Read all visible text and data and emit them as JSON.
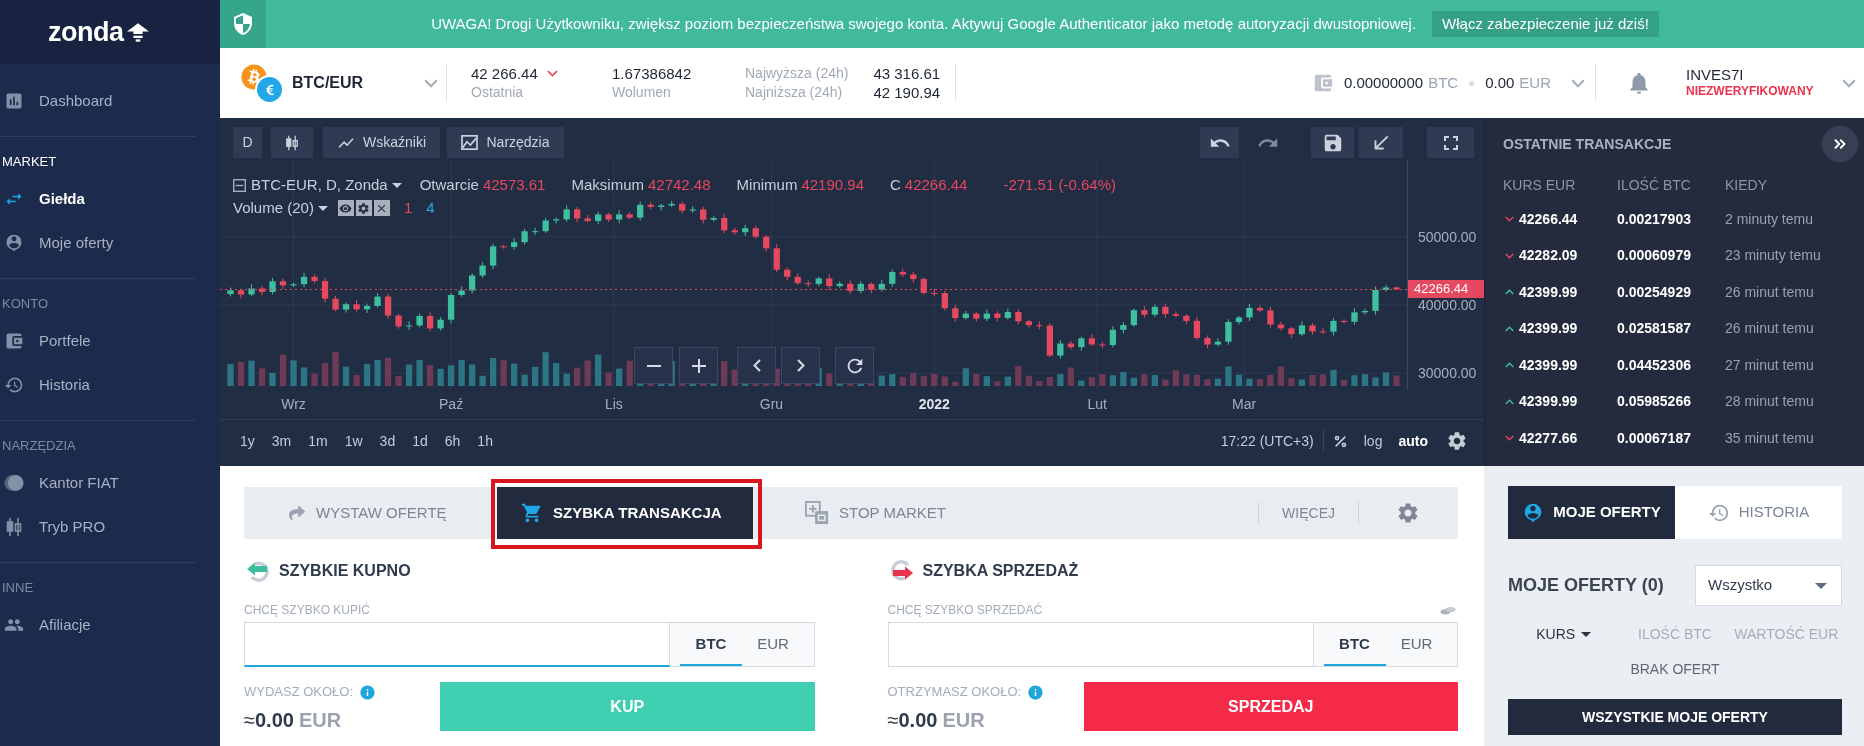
{
  "sidebar": {
    "logo": "zonda",
    "items": [
      {
        "label": "Dashboard",
        "selected": false
      }
    ],
    "sections": [
      {
        "title": "MARKET",
        "active": true,
        "items": [
          {
            "label": "Giełda",
            "selected": true
          },
          {
            "label": "Moje oferty",
            "selected": false
          }
        ]
      },
      {
        "title": "KONTO",
        "active": false,
        "items": [
          {
            "label": "Portfele",
            "selected": false
          },
          {
            "label": "Historia",
            "selected": false
          }
        ]
      },
      {
        "title": "NARZĘDZIA",
        "active": false,
        "items": [
          {
            "label": "Kantor FIAT",
            "selected": false
          },
          {
            "label": "Tryb PRO",
            "selected": false
          }
        ]
      },
      {
        "title": "INNE",
        "active": false,
        "items": [
          {
            "label": "Afiliacje",
            "selected": false
          }
        ]
      }
    ]
  },
  "banner": {
    "text": "UWAGA! Drogi Użytkowniku, zwiększ poziom bezpieczeństwa swojego konta. Aktywuj Google Authenticator jako metodę autoryzacji dwustopniowej.",
    "button": "Włącz zabezpieczenie już dziś!"
  },
  "header": {
    "pair": "BTC/EUR",
    "last": {
      "value": "42 266.44",
      "label": "Ostatnia",
      "falling": true
    },
    "volume": {
      "value": "1.67386842",
      "label": "Wolumen"
    },
    "range": [
      {
        "label": "Najwyższa (24h)",
        "value": "43 316.61"
      },
      {
        "label": "Najniższa (24h)",
        "value": "42 190.94"
      }
    ],
    "balance": [
      {
        "amount": "0.00000000",
        "unit": "BTC"
      },
      {
        "amount": "0.00",
        "unit": "EUR"
      }
    ],
    "user": {
      "name": "INVES7I",
      "status": "NIEZWERYFIKOWANY",
      "verified": false
    }
  },
  "chart": {
    "toolbar": {
      "interval": "D",
      "indicators": "Wskaźniki",
      "tools": "Narzędzia",
      "redo_disabled": true
    },
    "legend": {
      "symbol": "BTC-EUR, D, Zonda",
      "values": [
        {
          "label": "Otwarcie",
          "value": "42573.61"
        },
        {
          "label": "Maksimum",
          "value": "42742.48"
        },
        {
          "label": "Minimum",
          "value": "42190.94"
        },
        {
          "label": "C",
          "value": "42266.44"
        }
      ],
      "change": "-271.51 (-0.64%)",
      "volume": "Volume (20)",
      "volume_values": [
        {
          "text": "1",
          "color": "#e8475f"
        },
        {
          "text": "4",
          "color": "#2aa7e6"
        }
      ]
    },
    "chart_data": {
      "type": "candlestick",
      "x": [
        "2021-08-20",
        "2021-08-22",
        "2021-08-24",
        "2021-08-26",
        "2021-08-28",
        "2021-08-30",
        "2021-09-01",
        "2021-09-03",
        "2021-09-05",
        "2021-09-07",
        "2021-09-09",
        "2021-09-11",
        "2021-09-13",
        "2021-09-15",
        "2021-09-17",
        "2021-09-19",
        "2021-09-21",
        "2021-09-23",
        "2021-09-25",
        "2021-09-27",
        "2021-09-29",
        "2021-10-01",
        "2021-10-03",
        "2021-10-05",
        "2021-10-07",
        "2021-10-09",
        "2021-10-11",
        "2021-10-13",
        "2021-10-15",
        "2021-10-17",
        "2021-10-19",
        "2021-10-21",
        "2021-10-23",
        "2021-10-25",
        "2021-10-27",
        "2021-10-29",
        "2021-10-31",
        "2021-11-02",
        "2021-11-04",
        "2021-11-06",
        "2021-11-08",
        "2021-11-10",
        "2021-11-12",
        "2021-11-14",
        "2021-11-16",
        "2021-11-18",
        "2021-11-20",
        "2021-11-22",
        "2021-11-24",
        "2021-11-26",
        "2021-11-28",
        "2021-11-30",
        "2021-12-02",
        "2021-12-04",
        "2021-12-06",
        "2021-12-08",
        "2021-12-10",
        "2021-12-12",
        "2021-12-14",
        "2021-12-16",
        "2021-12-18",
        "2021-12-20",
        "2021-12-22",
        "2021-12-24",
        "2021-12-26",
        "2021-12-28",
        "2021-12-30",
        "2022-01-01",
        "2022-01-03",
        "2022-01-05",
        "2022-01-07",
        "2022-01-09",
        "2022-01-11",
        "2022-01-13",
        "2022-01-15",
        "2022-01-17",
        "2022-01-19",
        "2022-01-21",
        "2022-01-23",
        "2022-01-25",
        "2022-01-27",
        "2022-01-29",
        "2022-01-31",
        "2022-02-02",
        "2022-02-04",
        "2022-02-06",
        "2022-02-08",
        "2022-02-10",
        "2022-02-12",
        "2022-02-14",
        "2022-02-16",
        "2022-02-18",
        "2022-02-20",
        "2022-02-22",
        "2022-02-24",
        "2022-02-26",
        "2022-02-28",
        "2022-03-02",
        "2022-03-04",
        "2022-03-06",
        "2022-03-08",
        "2022-03-10",
        "2022-03-12",
        "2022-03-14",
        "2022-03-16",
        "2022-03-18",
        "2022-03-20",
        "2022-03-22",
        "2022-03-24",
        "2022-03-26",
        "2022-03-28",
        "2022-03-30"
      ],
      "ohlc": [
        [
          41600,
          42550,
          41250,
          42150
        ],
        [
          42150,
          42400,
          40980,
          41530
        ],
        [
          41530,
          43020,
          41280,
          42420
        ],
        [
          42420,
          42770,
          41450,
          41900
        ],
        [
          41900,
          43980,
          41550,
          43480
        ],
        [
          43480,
          43880,
          42320,
          42870
        ],
        [
          42870,
          43300,
          42620,
          43050
        ],
        [
          43050,
          44730,
          42600,
          44130
        ],
        [
          44130,
          44480,
          43170,
          43520
        ],
        [
          43520,
          44020,
          40370,
          40920
        ],
        [
          40920,
          41320,
          39070,
          39320
        ],
        [
          39320,
          40350,
          38870,
          40100
        ],
        [
          40100,
          40700,
          39010,
          39360
        ],
        [
          39360,
          40200,
          38810,
          39850
        ],
        [
          39850,
          41730,
          39600,
          41230
        ],
        [
          41230,
          41630,
          37990,
          38440
        ],
        [
          38440,
          38690,
          36500,
          36850
        ],
        [
          36850,
          37580,
          36300,
          36980
        ],
        [
          36980,
          38730,
          36730,
          38380
        ],
        [
          38380,
          38880,
          36100,
          36550
        ],
        [
          36550,
          38230,
          36200,
          37830
        ],
        [
          37830,
          41710,
          37280,
          41460
        ],
        [
          41460,
          42720,
          41210,
          42120
        ],
        [
          42120,
          44670,
          41670,
          44320
        ],
        [
          44320,
          46280,
          43970,
          45780
        ],
        [
          45780,
          49010,
          45230,
          48610
        ],
        [
          48610,
          48860,
          48270,
          48520
        ],
        [
          48520,
          49820,
          48070,
          49220
        ],
        [
          49220,
          51170,
          48870,
          50820
        ],
        [
          50820,
          51340,
          50270,
          50840
        ],
        [
          50840,
          52810,
          50590,
          52410
        ],
        [
          52410,
          52830,
          51960,
          52580
        ],
        [
          52580,
          54650,
          52230,
          54050
        ],
        [
          54050,
          54400,
          52170,
          52720
        ],
        [
          52720,
          53220,
          52090,
          52340
        ],
        [
          52340,
          53700,
          51890,
          53300
        ],
        [
          53300,
          53550,
          52200,
          52550
        ],
        [
          52550,
          53910,
          52000,
          53310
        ],
        [
          53310,
          53660,
          52580,
          52830
        ],
        [
          52830,
          55220,
          52380,
          54720
        ],
        [
          54720,
          55120,
          54050,
          54400
        ],
        [
          54400,
          54870,
          53850,
          54620
        ],
        [
          54620,
          55300,
          54370,
          54860
        ],
        [
          54860,
          55210,
          53410,
          53860
        ],
        [
          53860,
          54530,
          53510,
          54030
        ],
        [
          54030,
          54430,
          51970,
          52520
        ],
        [
          52520,
          53030,
          52270,
          52780
        ],
        [
          52780,
          53380,
          50520,
          50970
        ],
        [
          50970,
          51320,
          50330,
          50680
        ],
        [
          50680,
          51780,
          50130,
          51280
        ],
        [
          51280,
          51680,
          49790,
          50040
        ],
        [
          50040,
          50290,
          47870,
          48320
        ],
        [
          48320,
          48920,
          44830,
          45180
        ],
        [
          45180,
          45530,
          43590,
          44140
        ],
        [
          44140,
          44640,
          42950,
          43200
        ],
        [
          43200,
          43600,
          42650,
          43100
        ],
        [
          43100,
          44150,
          42750,
          43900
        ],
        [
          43900,
          44500,
          42220,
          42770
        ],
        [
          42770,
          43460,
          42520,
          43110
        ],
        [
          43110,
          43610,
          41600,
          42050
        ],
        [
          42050,
          43490,
          41700,
          43090
        ],
        [
          43090,
          43340,
          41700,
          42250
        ],
        [
          42250,
          43700,
          42000,
          43100
        ],
        [
          43100,
          45190,
          42650,
          44840
        ],
        [
          44840,
          45340,
          44120,
          44470
        ],
        [
          44470,
          44870,
          43260,
          43810
        ],
        [
          43810,
          44060,
          41510,
          41760
        ],
        [
          41760,
          42360,
          41290,
          41740
        ],
        [
          41740,
          42090,
          39160,
          39510
        ],
        [
          39510,
          40010,
          37530,
          38080
        ],
        [
          38080,
          39120,
          37830,
          38720
        ],
        [
          38720,
          38970,
          37530,
          37980
        ],
        [
          37980,
          39330,
          37630,
          38730
        ],
        [
          38730,
          39080,
          37540,
          38090
        ],
        [
          38090,
          39460,
          37840,
          38960
        ],
        [
          38960,
          39360,
          37150,
          37600
        ],
        [
          37600,
          37850,
          36680,
          37030
        ],
        [
          37030,
          37630,
          36420,
          36970
        ],
        [
          36970,
          37320,
          32310,
          32560
        ],
        [
          32560,
          34830,
          32110,
          34330
        ],
        [
          34330,
          34730,
          33450,
          33800
        ],
        [
          33800,
          35350,
          33250,
          35100
        ],
        [
          35100,
          35700,
          33950,
          34200
        ],
        [
          34200,
          34550,
          33650,
          34100
        ],
        [
          34100,
          36850,
          33750,
          36350
        ],
        [
          36350,
          37440,
          35800,
          37040
        ],
        [
          37040,
          39480,
          36790,
          39230
        ],
        [
          39230,
          39830,
          38120,
          38570
        ],
        [
          38570,
          40070,
          38220,
          39720
        ],
        [
          39720,
          40220,
          38110,
          38660
        ],
        [
          38660,
          39060,
          38160,
          38410
        ],
        [
          38410,
          38660,
          37210,
          37660
        ],
        [
          37660,
          38260,
          34810,
          35160
        ],
        [
          35160,
          35510,
          33630,
          34180
        ],
        [
          34180,
          35100,
          33930,
          34600
        ],
        [
          34600,
          37890,
          34150,
          37490
        ],
        [
          37490,
          38410,
          37140,
          38160
        ],
        [
          38160,
          40160,
          37610,
          39560
        ],
        [
          39560,
          39910,
          38940,
          39190
        ],
        [
          39190,
          39690,
          36670,
          37120
        ],
        [
          37120,
          37520,
          36210,
          36560
        ],
        [
          36560,
          36810,
          35150,
          35700
        ],
        [
          35700,
          37600,
          35450,
          37000
        ],
        [
          37000,
          37350,
          35650,
          36100
        ],
        [
          36100,
          36600,
          35720,
          36070
        ],
        [
          36070,
          38050,
          35520,
          37650
        ],
        [
          37650,
          37900,
          37280,
          37530
        ],
        [
          37530,
          39510,
          37080,
          38910
        ],
        [
          38910,
          39470,
          38560,
          39120
        ],
        [
          39120,
          42700,
          38570,
          42200
        ],
        [
          42200,
          42970,
          41950,
          42570
        ],
        [
          42573.61,
          42742.48,
          42190.94,
          42266.44
        ]
      ],
      "xlim": [
        "2021-08-18",
        "2022-04-01"
      ],
      "ylim": [
        27500,
        61300
      ],
      "xticks": [
        {
          "value": "2021-09-01",
          "label": "Wrz"
        },
        {
          "value": "2021-10-01",
          "label": "Paź"
        },
        {
          "value": "2021-11-01",
          "label": "Lis"
        },
        {
          "value": "2021-12-01",
          "label": "Gru"
        },
        {
          "value": "2022-01-01",
          "label": "2022"
        },
        {
          "value": "2022-02-01",
          "label": "Lut"
        },
        {
          "value": "2022-03-01",
          "label": "Mar"
        }
      ],
      "yticks": [
        {
          "value": 50000,
          "label": "50000.00"
        },
        {
          "value": 40000,
          "label": "40000.00"
        },
        {
          "value": 30000,
          "label": "30000.00"
        }
      ],
      "grid": true,
      "ref_lines": [
        {
          "axis": "y",
          "value": 42266.44,
          "label": "42266.44"
        }
      ]
    },
    "ranges": [
      "1y",
      "3m",
      "1m",
      "1w",
      "3d",
      "1d",
      "6h",
      "1h"
    ],
    "time": "17:22 (UTC+3)",
    "scale_options": [
      {
        "label": "log",
        "selected": false
      },
      {
        "label": "auto",
        "selected": true
      }
    ]
  },
  "trades": {
    "title": "OSTATNIE TRANSAKCJE",
    "columns": [
      "KURS EUR",
      "ILOŚĆ BTC",
      "KIEDY"
    ],
    "rows": [
      {
        "rising": false,
        "price": "42266.44",
        "amount": "0.00217903",
        "time": "2 minuty temu"
      },
      {
        "rising": false,
        "price": "42282.09",
        "amount": "0.00060979",
        "time": "23 minuty temu"
      },
      {
        "rising": true,
        "price": "42399.99",
        "amount": "0.00254929",
        "time": "26 minut temu"
      },
      {
        "rising": true,
        "price": "42399.99",
        "amount": "0.02581587",
        "time": "26 minut temu"
      },
      {
        "rising": true,
        "price": "42399.99",
        "amount": "0.04452306",
        "time": "27 minut temu"
      },
      {
        "rising": true,
        "price": "42399.99",
        "amount": "0.05985266",
        "time": "28 minut temu"
      },
      {
        "rising": false,
        "price": "42277.66",
        "amount": "0.00067187",
        "time": "35 minut temu"
      }
    ]
  },
  "order_panel": {
    "tabs": [
      {
        "label": "WYSTAW OFERTĘ",
        "selected": false,
        "highlighted": false
      },
      {
        "label": "SZYBKA TRANSAKCJA",
        "selected": true,
        "highlighted": true
      },
      {
        "label": "STOP MARKET",
        "selected": false,
        "highlighted": false
      }
    ],
    "more": "WIĘCEJ",
    "forms": [
      {
        "kind": "buy",
        "title": "SZYBKIE KUPNO",
        "field_label": "CHCĘ SZYBKO KUPIĆ",
        "focused": true,
        "currencies": [
          {
            "label": "BTC",
            "selected": true
          },
          {
            "label": "EUR",
            "selected": false
          }
        ],
        "estimate_label": "WYDASZ OKOŁO:",
        "estimate": "≈**0.00**",
        "estimate_unit": "EUR",
        "button": "KUP"
      },
      {
        "kind": "sell",
        "title": "SZYBKA SPRZEDAŻ",
        "field_label": "CHCĘ SZYBKO SPRZEDAĆ",
        "focused": false,
        "currencies": [
          {
            "label": "BTC",
            "selected": true
          },
          {
            "label": "EUR",
            "selected": false
          }
        ],
        "estimate_label": "OTRZYMASZ OKOŁO:",
        "estimate": "≈**0.00**",
        "estimate_unit": "EUR",
        "button": "SPRZEDAJ"
      }
    ]
  },
  "orders_panel": {
    "tabs": [
      {
        "label": "MOJE OFERTY",
        "selected": true
      },
      {
        "label": "HISTORIA",
        "selected": false
      }
    ],
    "title": "MOJE OFERTY (0)",
    "filter": "Wszystko",
    "columns": [
      {
        "label": "KURS",
        "sorted": true
      },
      {
        "label": "ILOŚĆ BTC",
        "sorted": false
      },
      {
        "label": "WARTOŚĆ EUR",
        "sorted": false
      }
    ],
    "empty": "BRAK OFERT",
    "button": "WSZYSTKIE MOJE OFERTY"
  }
}
